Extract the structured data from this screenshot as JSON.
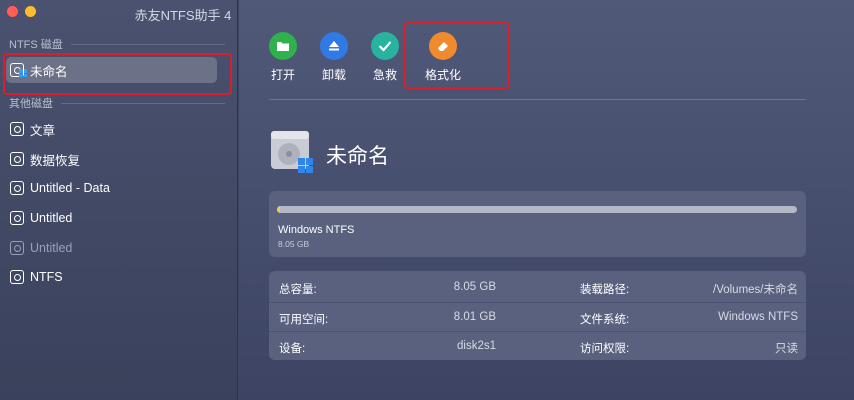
{
  "window": {
    "title": "赤友NTFS助手 4"
  },
  "sidebar": {
    "ntfs_header": "NTFS 磁盘",
    "selected_item": "未命名",
    "other_header": "其他磁盘",
    "items": [
      {
        "label": "文章"
      },
      {
        "label": "数据恢复"
      },
      {
        "label": "Untitled - Data"
      },
      {
        "label": "Untitled"
      },
      {
        "label": "Untitled"
      },
      {
        "label": "NTFS"
      }
    ]
  },
  "toolbar": {
    "open_label": "打开",
    "eject_label": "卸载",
    "rescue_label": "急救",
    "format_label": "格式化"
  },
  "drive": {
    "name": "未命名",
    "filesystem": "Windows NTFS",
    "size": "8.05 GB",
    "used_fraction": 0.005
  },
  "info": {
    "total_label": "总容量:",
    "total_value": "8.05 GB",
    "mount_label": "装载路径:",
    "mount_value": "/Volumes/未命名",
    "free_label": "可用空间:",
    "free_value": "8.01 GB",
    "fs_label": "文件系统:",
    "fs_value": "Windows NTFS",
    "device_label": "设备:",
    "device_value": "disk2s1",
    "access_label": "访问权限:",
    "access_value": "只读"
  },
  "colors": {
    "highlight": "#d91f2a",
    "open": "#2fb14e",
    "eject": "#2f7ae5",
    "rescue": "#27b3a0",
    "format": "#f08a2e",
    "bar_fill": "#f2c94c"
  }
}
